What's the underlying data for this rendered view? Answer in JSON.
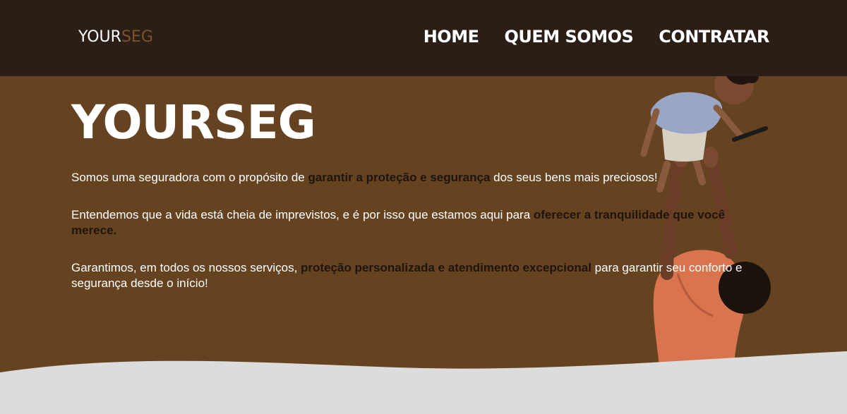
{
  "header": {
    "logo_main": "YOUR",
    "logo_accent": "SEG",
    "nav": [
      {
        "label": "HOME"
      },
      {
        "label": "QUEM SOMOS"
      },
      {
        "label": "CONTRATAR"
      }
    ]
  },
  "hero": {
    "title": "YOURSEG",
    "p1": {
      "before": "Somos uma seguradora com o propósito de ",
      "highlight": "garantir a proteção e segurança",
      "after": " dos seus bens mais preciosos!"
    },
    "p2": {
      "before": "Entendemos que a vida está cheia de imprevistos, e é por isso que estamos aqui para ",
      "highlight": "oferecer a tranquilidade que você merece.",
      "after": ""
    },
    "p3": {
      "before": "Garantimos, em todos os nossos serviços, ",
      "highlight": "proteção personalizada e atendimento excepcional",
      "after": " para garantir seu conforto e segurança desde o início!"
    }
  },
  "colors": {
    "topbar": "#2a1e16",
    "hero": "#654320",
    "accent": "#7a5428",
    "highlight_text": "#1e140c",
    "footer": "#dcdcdc"
  }
}
